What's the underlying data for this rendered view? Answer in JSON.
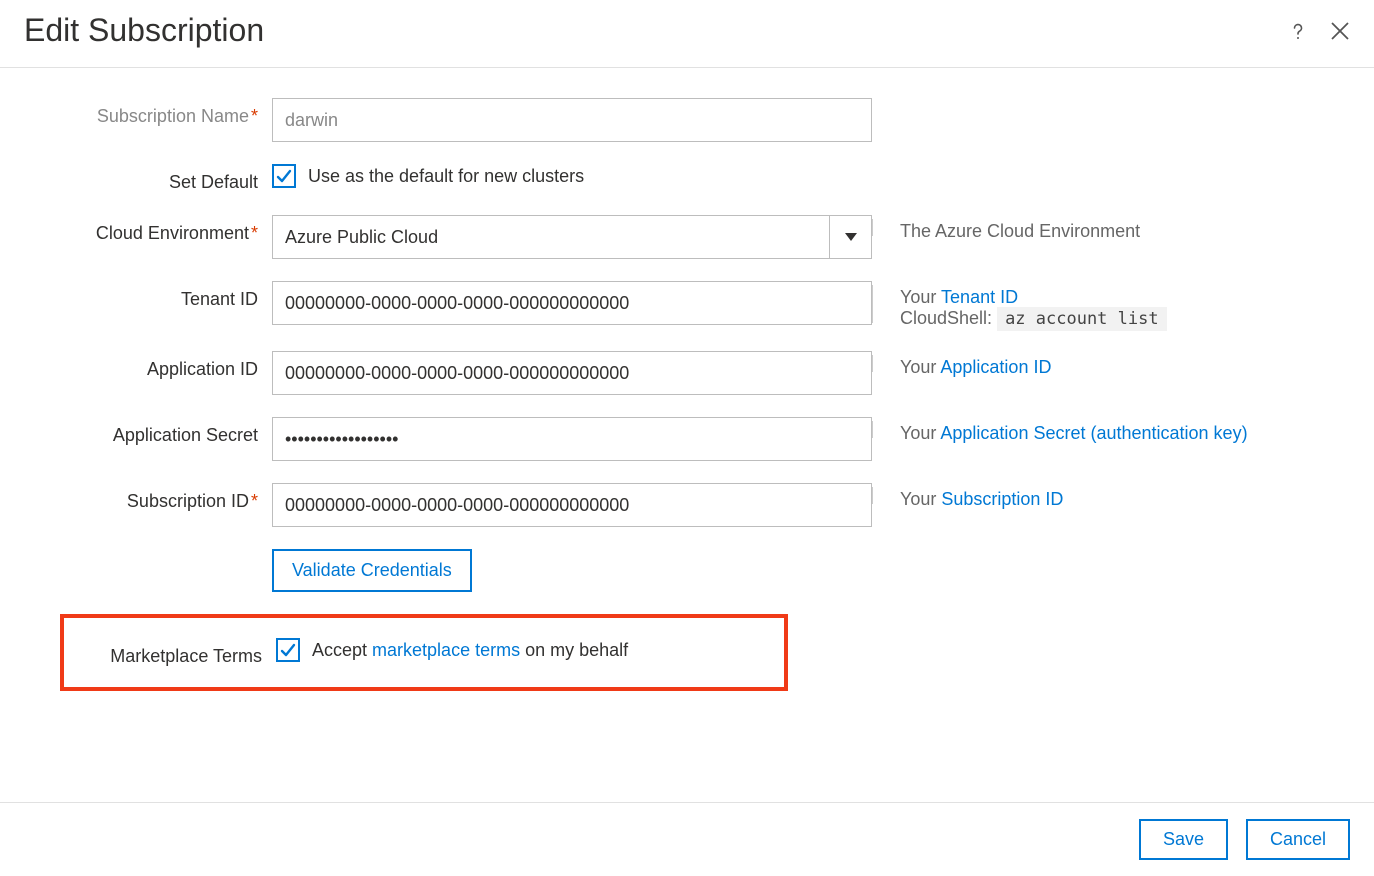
{
  "header": {
    "title": "Edit Subscription"
  },
  "form": {
    "subscription_name": {
      "label": "Subscription Name",
      "value": "darwin"
    },
    "set_default": {
      "label": "Set Default",
      "checked": true,
      "text": "Use as the default for new clusters"
    },
    "cloud_environment": {
      "label": "Cloud Environment",
      "value": "Azure Public Cloud",
      "help": "The Azure Cloud Environment"
    },
    "tenant_id": {
      "label": "Tenant ID",
      "value": "00000000-0000-0000-0000-000000000000",
      "help_prefix": "Your ",
      "help_link": "Tenant ID",
      "help_line2_prefix": "CloudShell: ",
      "help_code": "az account list"
    },
    "application_id": {
      "label": "Application ID",
      "value": "00000000-0000-0000-0000-000000000000",
      "help_prefix": "Your ",
      "help_link": "Application ID"
    },
    "application_secret": {
      "label": "Application Secret",
      "value": "••••••••••••••••••",
      "help_prefix": "Your ",
      "help_link": "Application Secret (authentication key)"
    },
    "subscription_id": {
      "label": "Subscription ID",
      "value": "00000000-0000-0000-0000-000000000000",
      "help_prefix": "Your ",
      "help_link": "Subscription ID"
    },
    "validate_button": "Validate Credentials",
    "marketplace_terms": {
      "label": "Marketplace Terms",
      "checked": true,
      "text_before": "Accept ",
      "link": "marketplace terms",
      "text_after": " on my behalf"
    }
  },
  "footer": {
    "save": "Save",
    "cancel": "Cancel"
  }
}
